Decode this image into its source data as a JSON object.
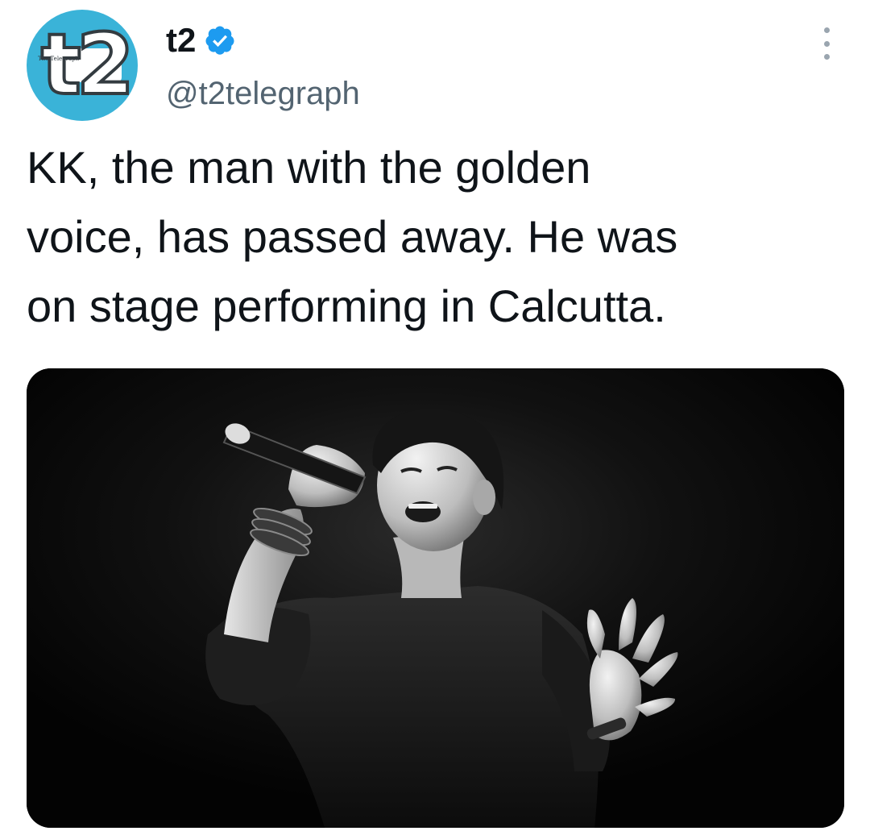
{
  "tweet": {
    "author": {
      "display_name": "t2",
      "handle": "@t2telegraph",
      "verified": true,
      "avatar": {
        "mark": "t2",
        "small_text": "The Telegraph",
        "background": "#3ab3d8"
      }
    },
    "text": "KK, the man with the golden\nvoice, has passed away. He was\non stage performing in Calcutta.",
    "media": {
      "icon": "photo-black-and-white-singer"
    }
  },
  "icons": {
    "verified": "verified-badge-icon",
    "more": "more-options-icon"
  },
  "colors": {
    "verified_blue": "#1d9bf0",
    "text": "#0f1419",
    "secondary_text": "#536471"
  }
}
